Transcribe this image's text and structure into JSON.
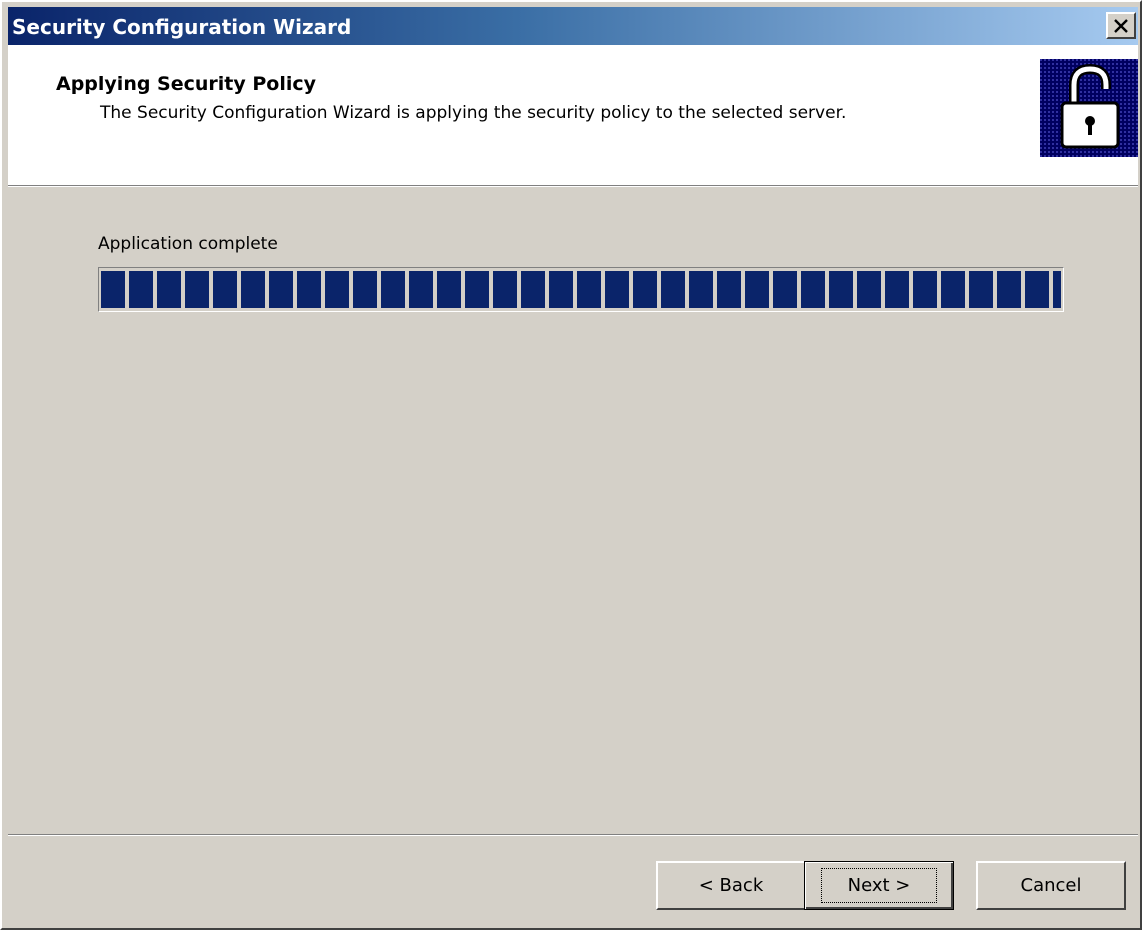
{
  "window": {
    "title": "Security Configuration Wizard",
    "close_icon": "close-icon"
  },
  "header": {
    "title": "Applying Security Policy",
    "description": "The Security Configuration Wizard is applying the security policy to the selected server.",
    "icon": "padlock-icon"
  },
  "progress": {
    "status": "Application complete",
    "percent": 100,
    "color": "#0a246a"
  },
  "buttons": {
    "back": "< Back",
    "next": "Next >",
    "cancel": "Cancel"
  },
  "colors": {
    "title_gradient_start": "#0a246a",
    "title_gradient_end": "#a6caf0",
    "face": "#d4d0c8"
  }
}
